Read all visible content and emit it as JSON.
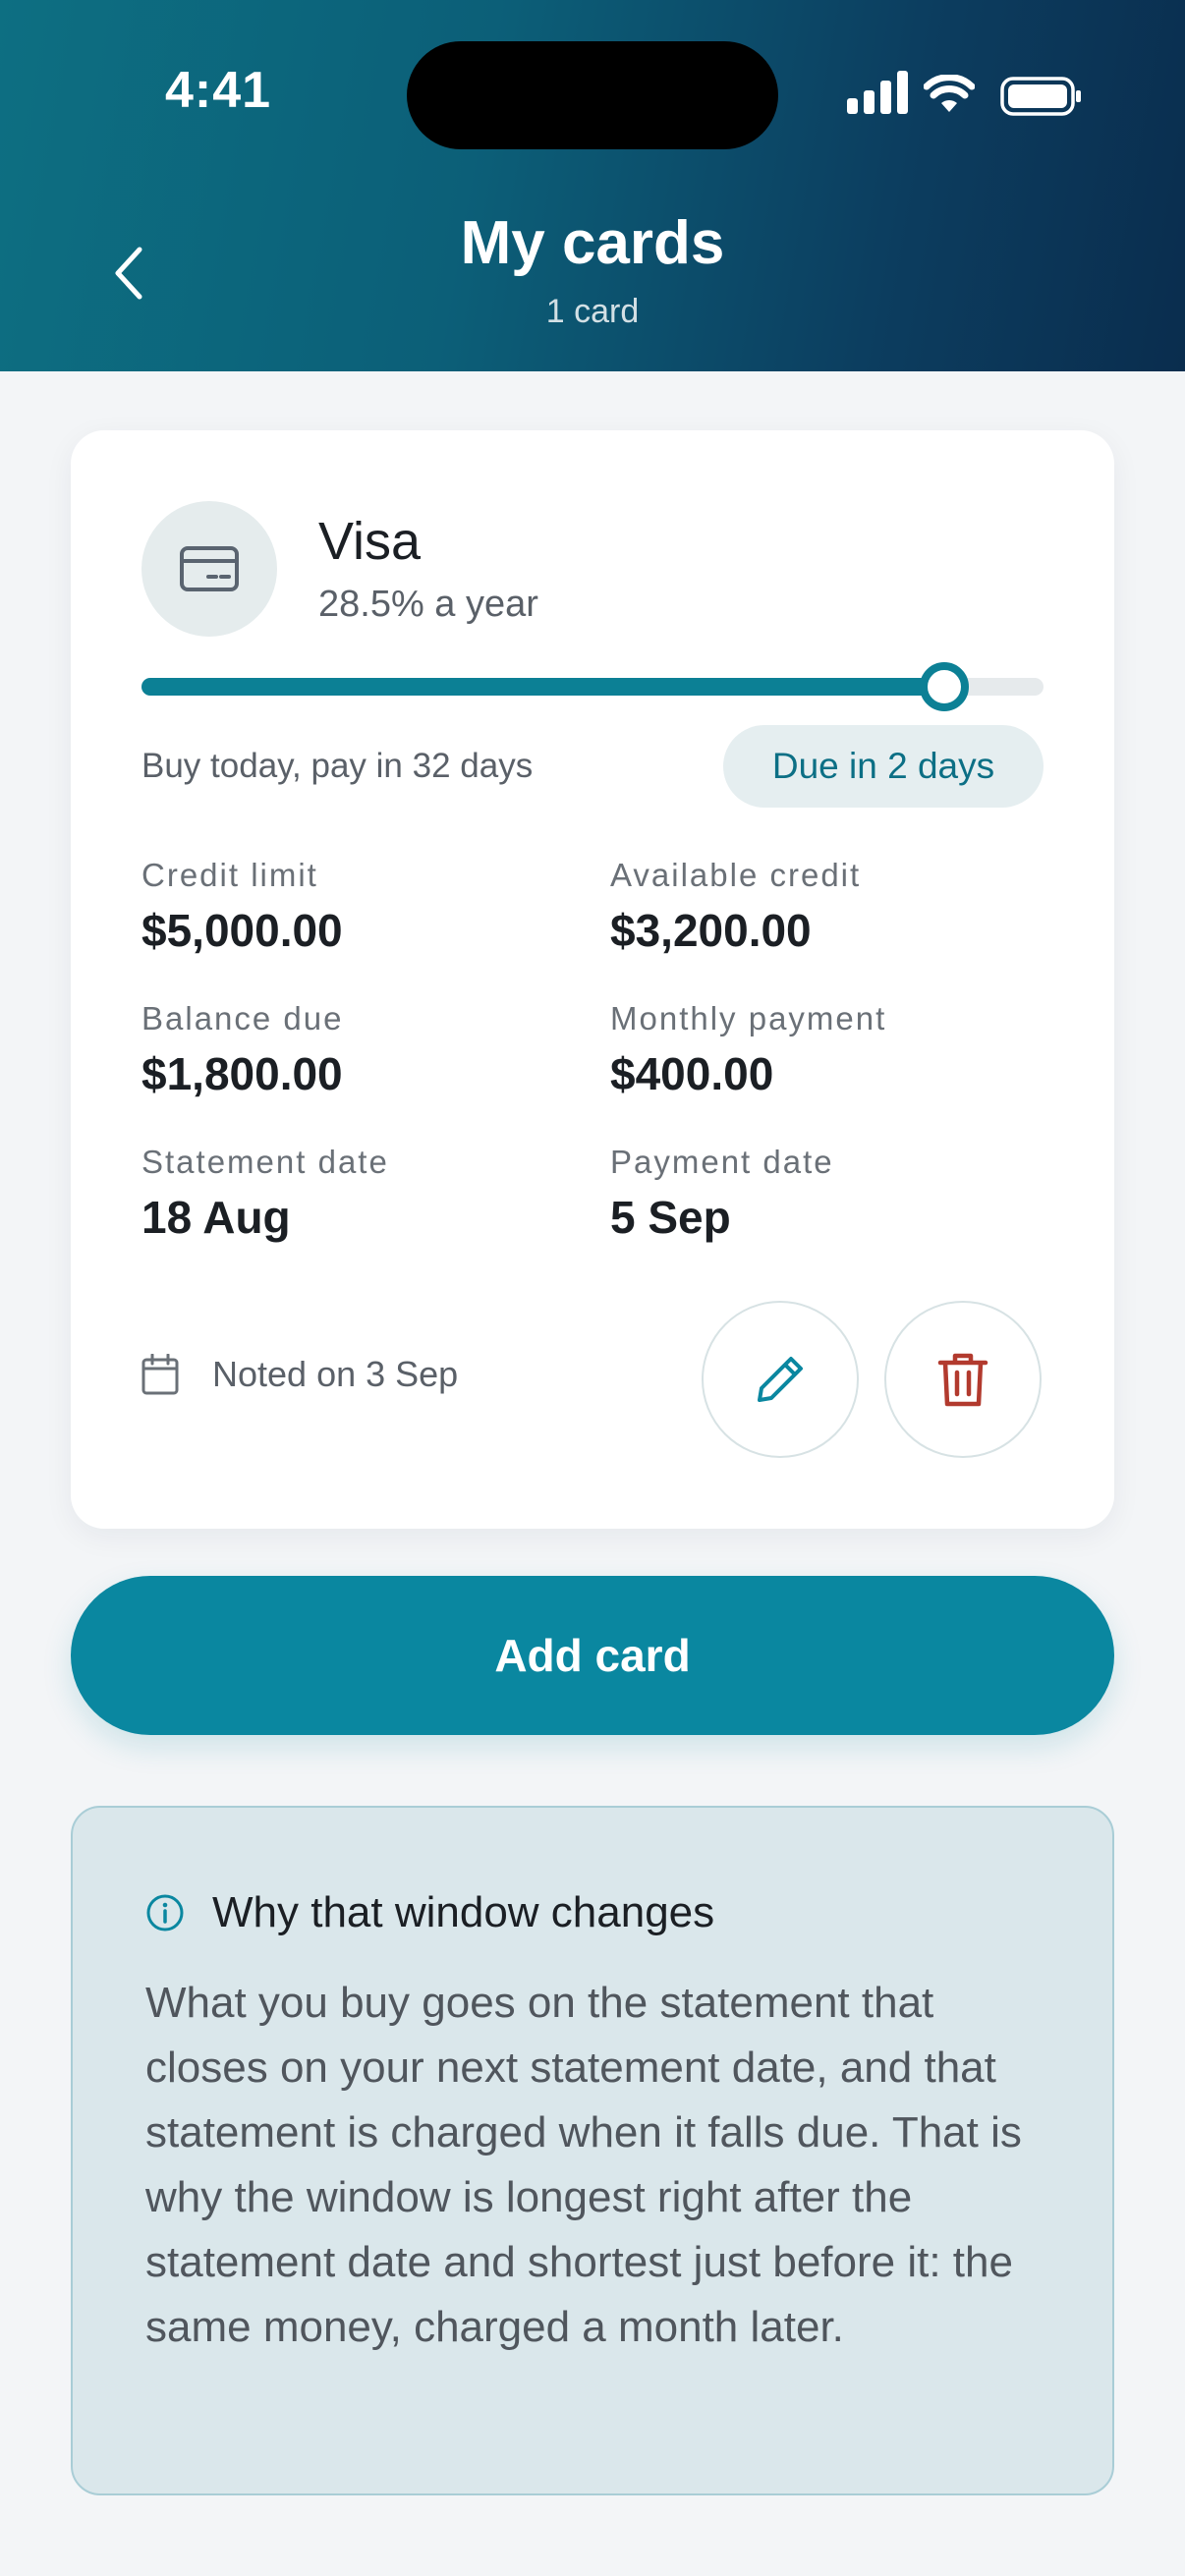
{
  "status_bar": {
    "time": "4:41"
  },
  "header": {
    "title": "My cards",
    "subtitle": "1 card"
  },
  "card": {
    "name": "Visa",
    "rate": "28.5% a year",
    "window_progress": 0.89,
    "pay_note": "Buy today, pay in 32 days",
    "due_badge": "Due in 2 days",
    "fields": [
      {
        "label": "Credit limit",
        "value": "$5,000.00"
      },
      {
        "label": "Available credit",
        "value": "$3,200.00"
      },
      {
        "label": "Balance due",
        "value": "$1,800.00"
      },
      {
        "label": "Monthly payment",
        "value": "$400.00"
      },
      {
        "label": "Statement date",
        "value": "18 Aug"
      },
      {
        "label": "Payment date",
        "value": "5 Sep"
      }
    ],
    "noted": "Noted on 3 Sep"
  },
  "add_button": {
    "label": "Add card"
  },
  "info": {
    "title": "Why that window changes",
    "body": "What you buy goes on the statement that closes on your next statement date, and that statement is charged when it falls due. That is why the window is longest right after the statement date and shortest just before it: the same money, charged a month later."
  },
  "colors": {
    "accent": "#0a87a0",
    "delete": "#b23a2e",
    "header_start": "#0d6f82",
    "header_end": "#0a2d4e"
  },
  "icons": {
    "back": "chevron-left-icon",
    "card": "credit-card-icon",
    "calendar": "calendar-icon",
    "edit": "pencil-icon",
    "delete": "trash-icon",
    "info": "info-icon"
  }
}
